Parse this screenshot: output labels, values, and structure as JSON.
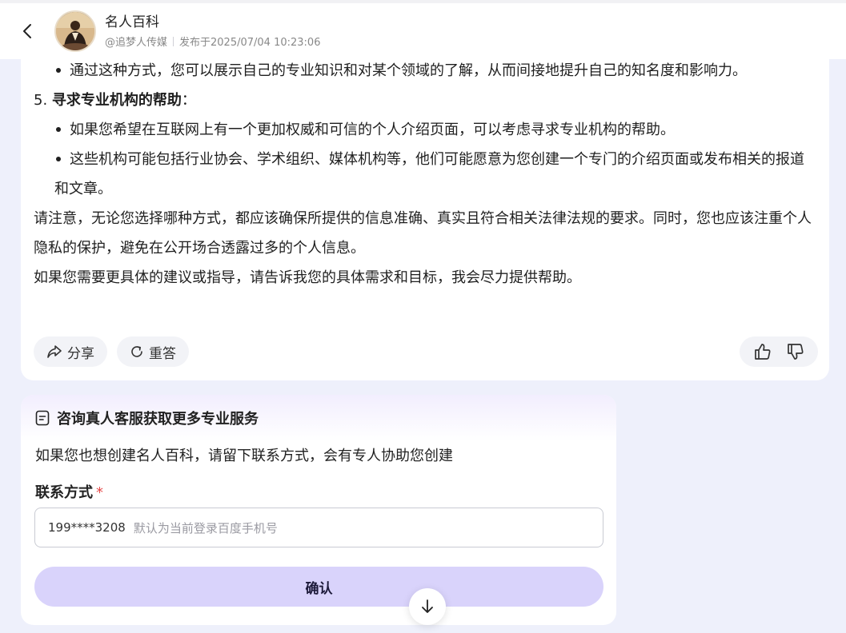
{
  "header": {
    "title": "名人百科",
    "author": "@追梦人传媒",
    "published": "发布于2025/07/04 10:23:06"
  },
  "answer": {
    "bullet_1": "通过这种方式，您可以展示自己的专业知识和对某个领域的了解，从而间接地提升自己的知名度和影响力。",
    "section_5_num": "5. ",
    "section_5_title": "寻求专业机构的帮助",
    "section_5_colon": "：",
    "bullet_2": "如果您希望在互联网上有一个更加权威和可信的个人介绍页面，可以考虑寻求专业机构的帮助。",
    "bullet_3": "这些机构可能包括行业协会、学术组织、媒体机构等，他们可能愿意为您创建一个专门的介绍页面或发布相关的报道和文章。",
    "para_1": "请注意，无论您选择哪种方式，都应该确保所提供的信息准确、真实且符合相关法律法规的要求。同时，您也应该注重个人隐私的保护，避免在公开场合透露过多的个人信息。",
    "para_2": "如果您需要更具体的建议或指导，请告诉我您的具体需求和目标，我会尽力提供帮助。"
  },
  "actions": {
    "share": "分享",
    "regenerate": "重答"
  },
  "consult": {
    "title": "咨询真人客服获取更多专业服务",
    "desc": "如果您也想创建名人百科，请留下联系方式，会有专人协助您创建",
    "field_label": "联系方式",
    "required_mark": "*",
    "phone_value": "199****3208",
    "phone_hint": "默认为当前登录百度手机号",
    "confirm": "确认"
  }
}
